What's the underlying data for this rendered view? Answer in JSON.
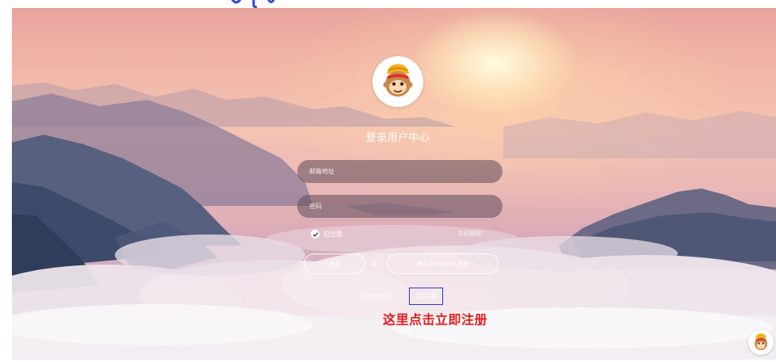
{
  "login": {
    "title": "登录用户中心",
    "email_placeholder": "邮箱地址",
    "password_placeholder": "密码",
    "remember_label": "记住我",
    "forgot_label": "忘记密码？",
    "login_button": "登录",
    "or_label": "或",
    "telegram_button": "使用 Telegram 登录",
    "no_account_text": "还没有账号？",
    "register_link": "立即注册"
  },
  "annotation": {
    "caption": "这里点击立即注册"
  },
  "icons": {
    "logo": "monkey-king-logo-icon",
    "checkbox": "check-icon",
    "corner": "monkey-avatar-icon"
  },
  "colors": {
    "caption_red": "#e41b1b",
    "highlight_blue": "#2b35d6",
    "input_fill": "#5f4b5a"
  }
}
